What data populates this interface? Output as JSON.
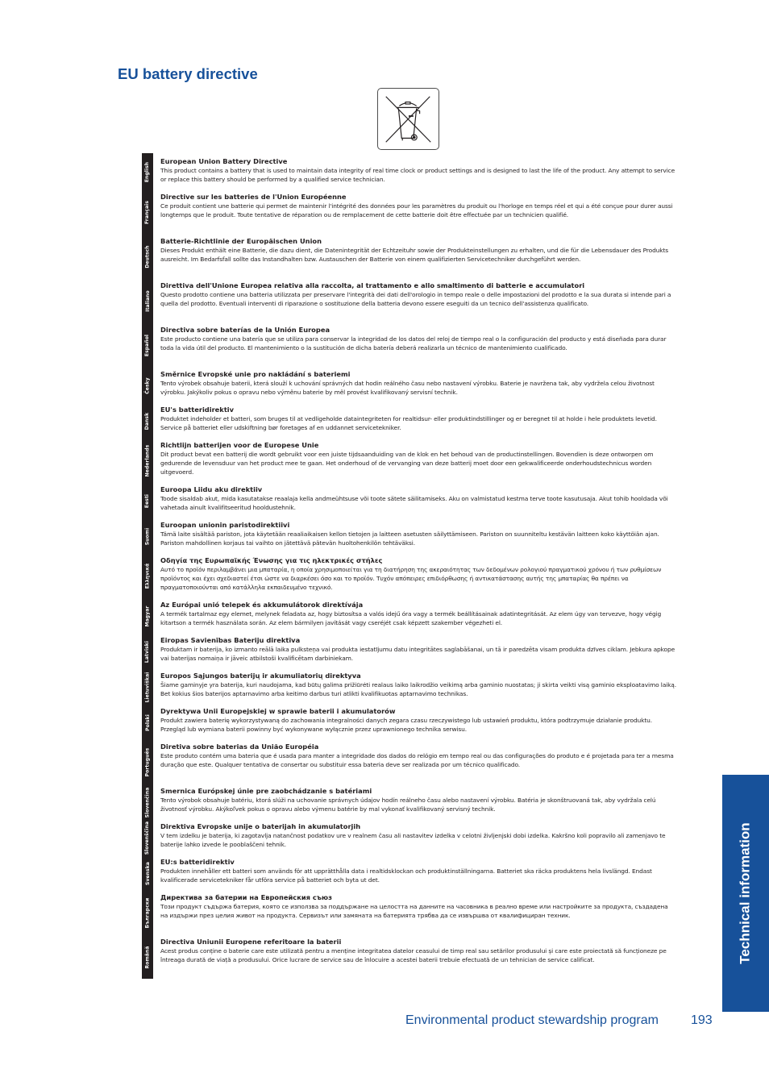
{
  "page": {
    "title": "EU battery directive",
    "symbol_icon": "crossed-out-wheelie-bin-icon"
  },
  "sections": [
    {
      "lang": "English",
      "heading": "European Union Battery Directive",
      "body": "This product contains a battery that is used to maintain data integrity of real time clock or product settings and is designed to last the life of the product.  Any attempt to service or replace this battery should be performed by a qualified service technician."
    },
    {
      "lang": "Français",
      "heading": "Directive sur les batteries de l'Union Européenne",
      "body": "Ce produit contient une batterie qui permet de maintenir l'intégrité des données pour les paramètres du produit ou l'horloge en temps réel et qui a été conçue pour durer aussi longtemps que le produit. Toute tentative de réparation ou de remplacement de cette batterie doit être effectuée par un technicien qualifié."
    },
    {
      "lang": "Deutsch",
      "heading": "Batterie-Richtlinie der Europäischen Union",
      "body": "Dieses Produkt enthält eine Batterie, die dazu dient, die Datenintegrität der Echtzeituhr sowie der Produkteinstellungen zu erhalten, und die für die Lebensdauer des Produkts ausreicht. Im Bedarfsfall sollte das Instandhalten bzw. Austauschen der Batterie von einem qualifizierten Servicetechniker durchgeführt werden."
    },
    {
      "lang": "Italiano",
      "heading": "Direttiva dell'Unione Europea relativa alla raccolta, al trattamento e allo smaltimento di batterie e accumulatori",
      "body": "Questo prodotto contiene una batteria utilizzata per preservare l'integrità dei dati dell'orologio in tempo reale o delle impostazioni del prodotto e la sua durata si intende pari a quella del prodotto. Eventuali interventi di riparazione o sostituzione della batteria devono essere eseguiti da un tecnico dell'assistenza qualificato."
    },
    {
      "lang": "Español",
      "heading": "Directiva sobre baterías de la Unión Europea",
      "body": "Este producto contiene una batería que se utiliza para conservar la integridad de los datos del reloj de tiempo real o la configuración del producto y está diseñada para durar toda la vida útil del producto. El mantenimiento o la sustitución de dicha batería deberá realizarla un técnico de mantenimiento cualificado."
    },
    {
      "lang": "Česky",
      "heading": "Směrnice Evropské unie pro nakládání s bateriemi",
      "body": "Tento výrobek obsahuje baterii, která slouží k uchování správných dat hodin reálného času nebo nastavení výrobku. Baterie je navržena tak, aby vydržela celou životnost výrobku. Jakýkoliv pokus o opravu nebo výměnu baterie by měl provést kvalifikovaný servisní technik."
    },
    {
      "lang": "Dansk",
      "heading": "EU's batteridirektiv",
      "body": "Produktet indeholder et batteri, som bruges til at vedligeholde dataintegriteten for realtidsur- eller produktindstillinger og er beregnet til at holde i hele produktets levetid. Service på batteriet eller udskiftning bør foretages af en uddannet servicetekniker."
    },
    {
      "lang": "Nederlands",
      "heading": "Richtlijn batterijen voor de Europese Unie",
      "body": "Dit product bevat een batterij die wordt gebruikt voor een juiste tijdsaanduiding van de klok en het behoud van de productinstellingen. Bovendien is deze ontworpen om gedurende de levensduur van het product mee te gaan. Het onderhoud of de vervanging van deze batterij moet door een gekwalificeerde onderhoudstechnicus worden uitgevoerd."
    },
    {
      "lang": "Eesti",
      "heading": "Euroopa Liidu aku direktiiv",
      "body": "Toode sisaldab akut, mida kasutatakse reaalaja kella andmeühtsuse või toote sätete säilitamiseks. Aku on valmistatud kestma terve toote kasutusaja. Akut tohib hooldada või vahetada ainult kvalifitseeritud hooldustehnik."
    },
    {
      "lang": "Suomi",
      "heading": "Euroopan unionin paristodirektiivi",
      "body": "Tämä laite sisältää pariston, jota käytetään reaaliaikaisen kellon tietojen ja laitteen asetusten säilyttämiseen. Pariston on suunniteltu kestävän laitteen koko käyttöiän ajan. Pariston mahdollinen korjaus tai vaihto on jätettävä pätevän huoltohenkilön tehtäväksi."
    },
    {
      "lang": "Ελληνικά",
      "heading": "Οδηγία της Ευρωπαϊκής Ένωσης για τις ηλεκτρικές στήλες",
      "body": "Αυτό το προϊόν περιλαμβάνει μια μπαταρία, η οποία χρησιμοποιείται για τη διατήρηση της ακεραιότητας των δεδομένων ρολογιού πραγματικού χρόνου ή των ρυθμίσεων προϊόντος και έχει σχεδιαστεί έτσι ώστε να διαρκέσει όσο και το προϊόν. Τυχόν απόπειρες επιδιόρθωσης ή αντικατάστασης αυτής της μπαταρίας θα πρέπει να πραγματοποιούνται από κατάλληλα εκπαιδευμένο τεχνικό."
    },
    {
      "lang": "Magyar",
      "heading": "Az Európai unió telepek és akkumulátorok direktívája",
      "body": "A termék tartalmaz egy elemet, melynek feladata az, hogy biztosítsa a valós idejű óra vagy a termék beállításainak adatintegritását. Az elem úgy van tervezve, hogy végig kitartson a termék használata során. Az elem bármilyen javítását vagy cseréjét csak képzett szakember végezheti el."
    },
    {
      "lang": "Latviski",
      "heading": "Eiropas Savienības Bateriju direktīva",
      "body": "Produktam ir baterija, ko izmanto reālā laika pulksteņa vai produkta iestatījumu datu integritātes saglabāšanai, un tā ir paredzēta visam produkta dzīves ciklam. Jebkura apkope vai baterijas nomaiņa ir jāveic atbilstoši kvalificētam darbiniekam."
    },
    {
      "lang": "Lietuviškai",
      "heading": "Europos Sąjungos baterijų ir akumuliatorių direktyva",
      "body": "Šiame gaminyje yra baterija, kuri naudojama, kad būtų galima prižiūrėti realaus laiko laikrodžio veikimą arba gaminio nuostatas; ji skirta veikti visą gaminio eksploatavimo laiką. Bet kokius šios baterijos aptarnavimo arba keitimo darbus turi atlikti kvalifikuotas aptarnavimo technikas."
    },
    {
      "lang": "Polski",
      "heading": "Dyrektywa Unii Europejskiej w sprawie baterii i akumulatorów",
      "body": "Produkt zawiera baterię wykorzystywaną do zachowania integralności danych zegara czasu rzeczywistego lub ustawień produktu, która podtrzymuje działanie produktu. Przegląd lub wymiana baterii powinny być wykonywane wyłącznie przez uprawnionego technika serwisu."
    },
    {
      "lang": "Português",
      "heading": "Diretiva sobre baterias da União Européia",
      "body": "Este produto contém uma bateria que é usada para manter a integridade dos dados do relógio em tempo real ou das configurações do produto e é projetada para ter a mesma duração que este. Qualquer tentativa de consertar ou substituir essa bateria deve ser realizada por um técnico qualificado."
    },
    {
      "lang": "Slovenčina",
      "heading": "Smernica Európskej únie pre zaobchádzanie s batériami",
      "body": "Tento výrobok obsahuje batériu, ktorá slúži na uchovanie správnych údajov hodín reálneho času alebo nastavení výrobku. Batéria je skonštruovaná tak, aby vydržala celú životnosť výrobku. Akýkoľvek pokus o opravu alebo výmenu batérie by mal vykonať kvalifikovaný servisný technik."
    },
    {
      "lang": "Slovenščina",
      "heading": "Direktiva Evropske unije o baterijah in akumulatorjih",
      "body": "V tem izdelku je baterija, ki zagotavlja natančnost podatkov ure v realnem času ali nastavitev izdelka v celotni življenjski dobi izdelka. Kakršno koli popravilo ali zamenjavo te baterije lahko izvede le pooblaščeni tehnik."
    },
    {
      "lang": "Svenska",
      "heading": "EU:s batteridirektiv",
      "body": "Produkten innehåller ett batteri som används för att upprätthålla data i realtidsklockan och produktinställningarna. Batteriet ska räcka produktens hela livslängd. Endast kvalificerade servicetekniker får utföra service på batteriet och byta ut det."
    },
    {
      "lang": "Български",
      "heading": "Директива за батерии на Европейския съюз",
      "body": "Този продукт съдържа батерия, която се използва за поддържане на целостта на данните на часовника в реално време или настройките за продукта, създадена на издържи през целия живот на продукта. Сервизът или замяната на батерията трябва да се извършва от квалифициран техник."
    },
    {
      "lang": "Română",
      "heading": "Directiva Uniunii Europene referitoare la baterii",
      "body": "Acest produs conține o baterie care este utilizată pentru a menține integritatea datelor ceasului de timp real sau setărilor produsului și care este proiectată să funcționeze pe întreaga durată de viață a produsului. Orice lucrare de service sau de înlocuire a acestei baterii trebuie efectuată de un tehnician de service calificat."
    }
  ],
  "side_tab": {
    "label": "Technical information"
  },
  "footer": {
    "section_title": "Environmental product stewardship program",
    "page_number": "193"
  }
}
